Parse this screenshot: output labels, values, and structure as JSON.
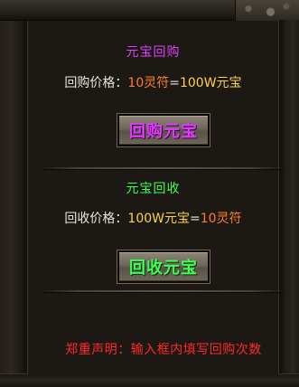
{
  "buyback": {
    "title": "元宝回购",
    "title_color": "#e040fb",
    "price_label": "回购价格：",
    "price_left": "10灵符",
    "equals": "=",
    "price_right": "100W元宝",
    "button_label": "回购元宝"
  },
  "recycle": {
    "title": "元宝回收",
    "title_color": "#3dff52",
    "price_label": "回收价格：",
    "price_left": "100W元宝",
    "equals": "=",
    "price_right": "10灵符",
    "button_label": "回收元宝"
  },
  "notice": "郑重声明：输入框内填写回购次数"
}
